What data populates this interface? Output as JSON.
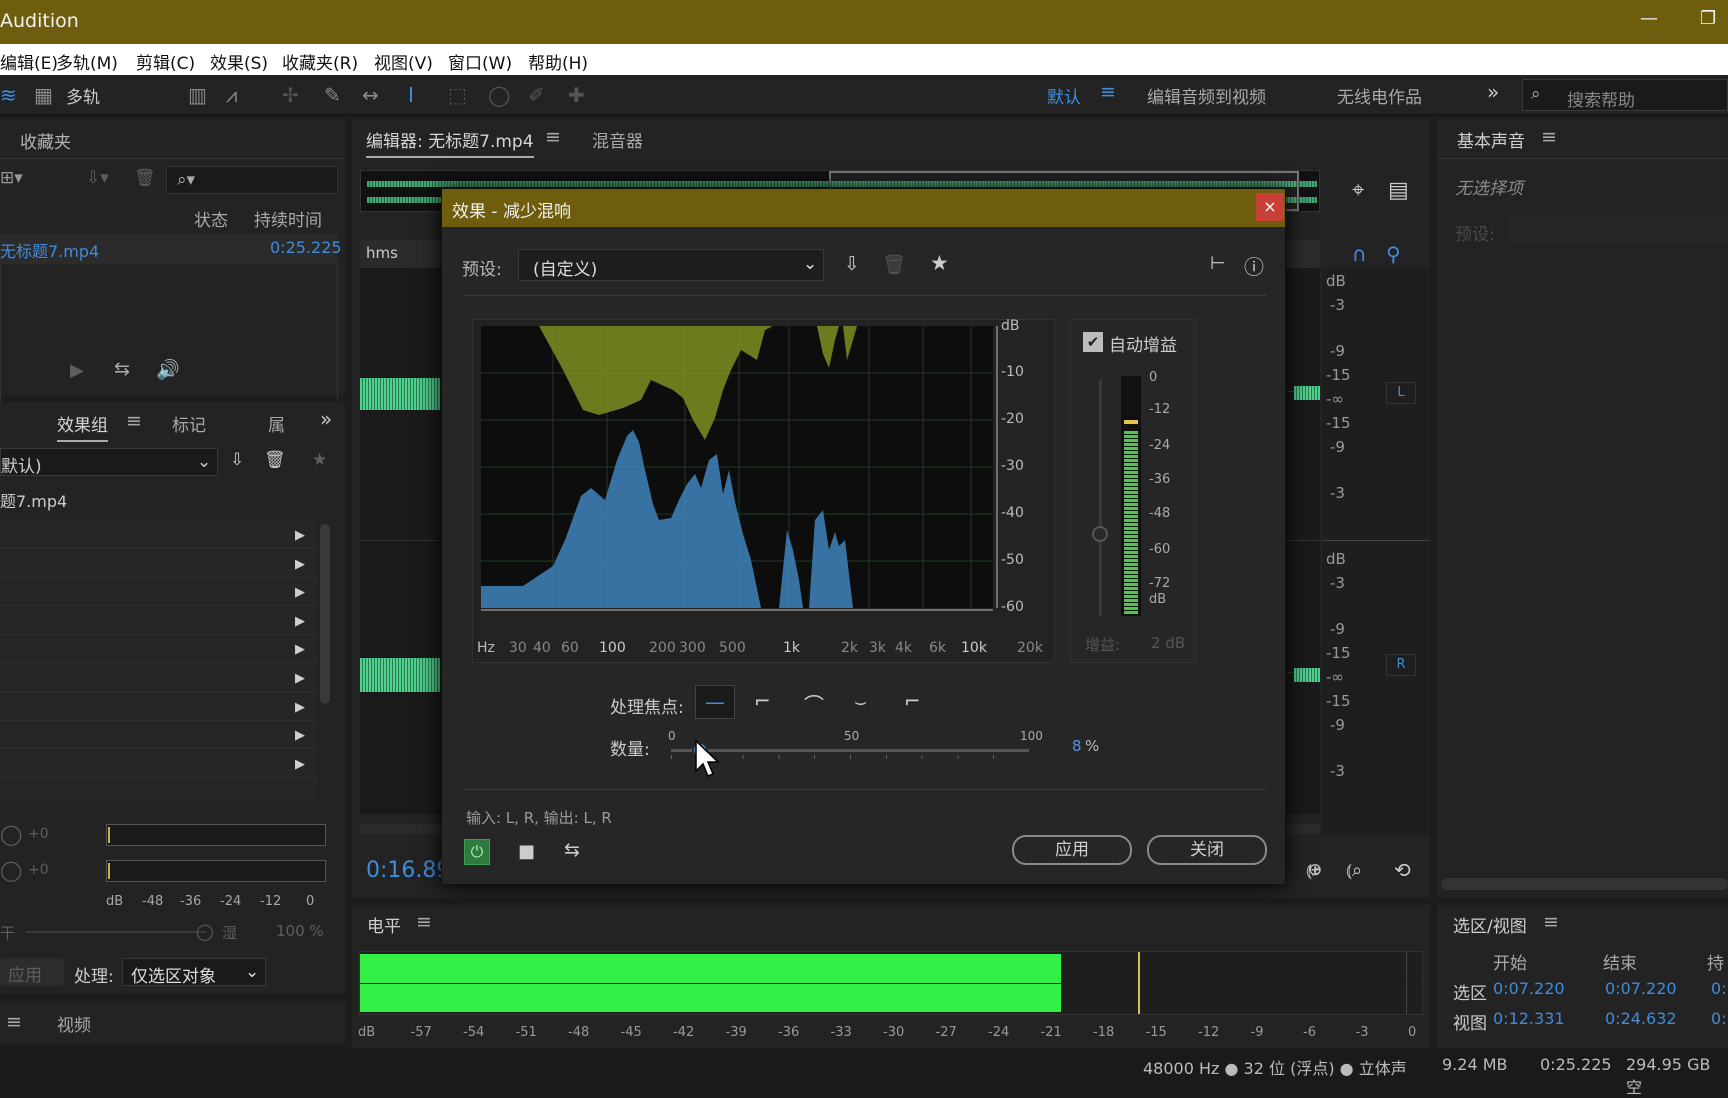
{
  "window": {
    "title": "Audition",
    "min_icon": "minimize-icon",
    "max_icon": "restore-icon"
  },
  "menu": [
    "编辑(E)",
    "多轨(M)",
    "剪辑(C)",
    "效果(S)",
    "收藏夹(R)",
    "视图(V)",
    "窗口(W)",
    "帮助(H)"
  ],
  "toolbar": {
    "multitrack": "多轨",
    "workspaces": [
      "默认",
      "编辑音频到视频",
      "无线电作品"
    ],
    "search_placeholder": "搜索帮助"
  },
  "left": {
    "favorites_tab": "收藏夹",
    "file_cols": [
      "状态",
      "持续时间"
    ],
    "file_name": "无标题7.mp4",
    "file_duration": "0:25.225",
    "tabs": [
      "效果组",
      "标记",
      "属"
    ],
    "preset": "默认)",
    "clip_name": "题7.mp4",
    "vol1": "+0",
    "vol2": "+0",
    "meter_ticks": [
      "dB",
      "-48",
      "-36",
      "-24",
      "-12",
      "0"
    ],
    "dry": "干",
    "wet": "湿",
    "mix": "100 %",
    "apply": "应用",
    "process_label": "处理:",
    "process_value": "仅选区对象",
    "video_tab": "视频"
  },
  "editor": {
    "tab": "编辑器: 无标题7.mp4",
    "mixer_tab": "混音器",
    "ruler": "hms",
    "time": "0:16.89",
    "db_top": [
      "dB",
      "-3",
      "-9",
      "-15",
      "-∞",
      "-15",
      "-9",
      "-3"
    ],
    "db_bottom": [
      "dB",
      "-3",
      "-9",
      "-15",
      "-∞",
      "-15",
      "-9",
      "-3"
    ],
    "ch_L": "L",
    "ch_R": "R"
  },
  "right": {
    "title": "基本声音",
    "no_selection": "无选择项",
    "preset_label": "预设:"
  },
  "dialog": {
    "title": "效果 - 减少混响",
    "preset_label": "预设:",
    "preset_value": "(自定义)",
    "graph_db": [
      "dB",
      "-10",
      "-20",
      "-30",
      "-40",
      "-50",
      "-60"
    ],
    "graph_hz": [
      "Hz",
      "30",
      "40",
      "60",
      "100",
      "200",
      "300",
      "500",
      "1k",
      "2k",
      "3k",
      "4k",
      "6k",
      "10k",
      "20k"
    ],
    "auto_gain": "自动增益",
    "meter_ticks": [
      "0",
      "-12",
      "-24",
      "-36",
      "-48",
      "-60",
      "-72",
      "dB"
    ],
    "gain_label": "增益:",
    "gain_value": "2 dB",
    "focus_label": "处理焦点:",
    "amount_label": "数量:",
    "amount_min": "0",
    "amount_mid": "50",
    "amount_max": "100",
    "amount_value": "8",
    "amount_unit": "%",
    "amount_fraction": 0.08,
    "io": "输入: L, R,  输出: L, R",
    "apply": "应用",
    "close": "关闭"
  },
  "levels": {
    "title": "电平",
    "ticks": [
      "dB",
      "-57",
      "-54",
      "-51",
      "-48",
      "-45",
      "-42",
      "-39",
      "-36",
      "-33",
      "-30",
      "-27",
      "-24",
      "-21",
      "-18",
      "-15",
      "-12",
      "-9",
      "-6",
      "-3",
      "0"
    ],
    "level_fraction": 0.66,
    "bar_color": "#33ee44"
  },
  "selview": {
    "title": "选区/视图",
    "cols": [
      "开始",
      "结束",
      "持"
    ],
    "rows": [
      {
        "label": "选区",
        "start": "0:07.220",
        "end": "0:07.220",
        "dur": "0:"
      },
      {
        "label": "视图",
        "start": "0:12.331",
        "end": "0:24.632",
        "dur": "0:"
      }
    ]
  },
  "status": {
    "format": "48000 Hz ● 32 位 (浮点) ● 立体声",
    "size": "9.24 MB",
    "duration": "0:25.225",
    "free": "294.95 GB 空"
  }
}
